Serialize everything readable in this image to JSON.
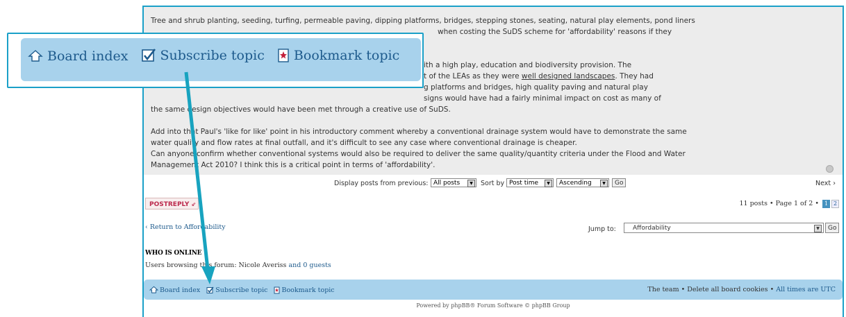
{
  "post": {
    "paragraphs": [
      "Tree and shrub planting, seeding, turfing, permeable paving, dipping platforms, bridges, stepping stones, seating, natural play elements, pond liners ... when costing the SuDS scheme for 'affordability' reasons if they",
      "...with a high play, education and biodiversity provision. The ... of the LEAs as they were well designed landscapes. They had ... platforms and bridges, high quality paving and natural play ... designs would have had a fairly minimal impact on cost as many of the same design objectives would have been met through a creative use of SuDS.",
      "Add into that Paul's 'like for like' point in his introductory comment whereby a conventional drainage system would have to demonstrate the same water quality and flow rates at final outfall, and it's difficult to see any case where conventional drainage is cheaper.",
      "Can anyone confirm whether conventional systems would also be required to deliver the same quality/quantity criteria under the Flood and Water Management Act 2010? I think this is a critical point in terms of 'affordability'."
    ],
    "line1": "Tree and shrub planting, seeding, turfing, permeable paving, dipping platforms, bridges, stepping stones, seating, natural play elements, pond liners",
    "line2": "when costing the SuDS scheme for 'affordability' reasons if they",
    "line3": "ith a high play, education and biodiversity provision. The",
    "line4a": "t of the LEAs as they were ",
    "line4u": "well designed landscapes",
    "line4b": ". They had",
    "line5": "g platforms and bridges, high quality paving and natural play",
    "line6": "signs would have had a fairly minimal impact on cost as many of",
    "line7": "the same design objectives would have been met through a creative use of SuDS.",
    "line8": "Add into that Paul's 'like for like' point in his introductory comment whereby a conventional drainage system would have to demonstrate the same",
    "line9": "water quality and flow rates at final outfall, and it's difficult to see any case where conventional drainage is cheaper.",
    "line10": "Can anyone confirm whether conventional systems would also be required to deliver the same quality/quantity criteria under the Flood and Water",
    "line11": "Management Act 2010? I think this is a critical point in terms of 'affordability'."
  },
  "zoom": {
    "board_index": "Board index",
    "subscribe": "Subscribe topic",
    "bookmark": "Bookmark topic"
  },
  "display": {
    "label": "Display posts from previous:",
    "posts_value": "All posts",
    "sort_label": "Sort by",
    "sort_value": "Post time",
    "order_value": "Ascending",
    "go": "Go",
    "next": "Next"
  },
  "actions": {
    "postreply": "POSTREPLY",
    "posts_count": "11 posts",
    "page_of": "Page 1 of 2",
    "page_current": "1",
    "page_next": "2"
  },
  "jump": {
    "return_text": "Return to Affordability",
    "label": "Jump to:",
    "selected": "Affordability",
    "go": "Go"
  },
  "online": {
    "heading": "WHO IS ONLINE",
    "prefix": "Users browsing this forum: Nicole Averiss",
    "suffix": "and 0 guests"
  },
  "navbar": {
    "board_index": "Board index",
    "subscribe": "Subscribe topic",
    "bookmark": "Bookmark topic",
    "team": "The team",
    "delete_cookies": "Delete all board cookies",
    "times": "All times are UTC"
  },
  "footer": {
    "powered": "Powered by phpBB® Forum Software © phpBB Group"
  },
  "colors": {
    "accent": "#1aa0c8",
    "navbar_bg": "#a8d2ec",
    "link": "#1d5a8c",
    "post_bg": "#ececec"
  }
}
